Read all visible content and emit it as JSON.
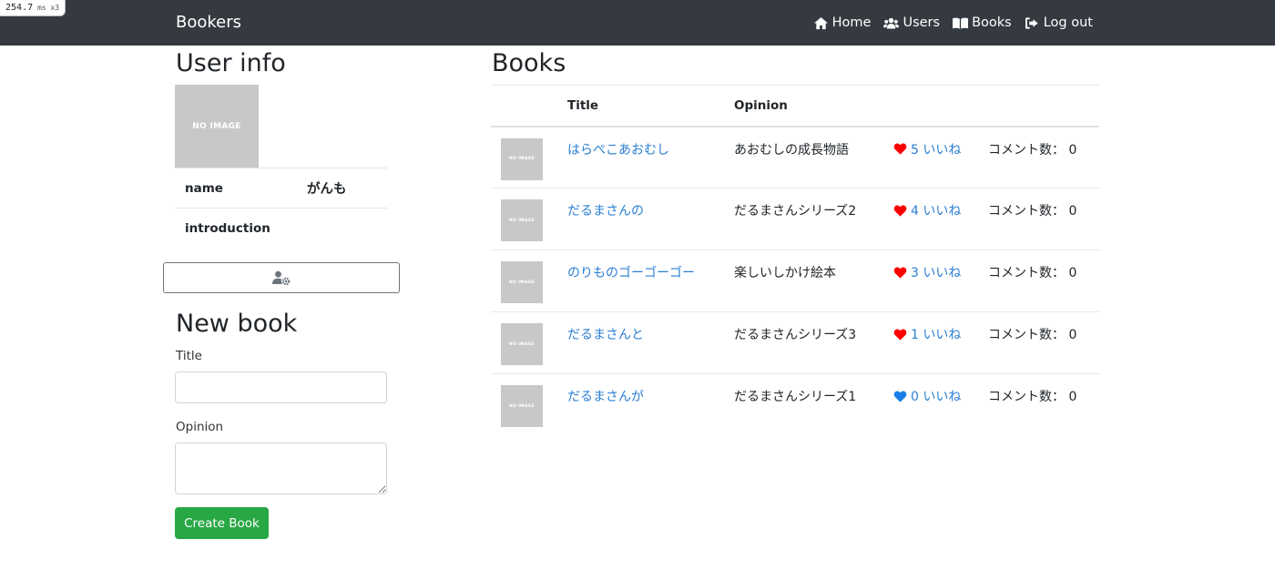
{
  "perf": {
    "value": "254.7",
    "unit": "ms",
    "mult": "x3"
  },
  "nav": {
    "brand": "Bookers",
    "links": [
      {
        "label": "Home",
        "icon": "home-icon"
      },
      {
        "label": "Users",
        "icon": "users-icon"
      },
      {
        "label": "Books",
        "icon": "book-icon"
      },
      {
        "label": "Log out",
        "icon": "logout-icon"
      }
    ]
  },
  "user_info": {
    "heading": "User info",
    "image_text": "NO IMAGE",
    "rows": [
      {
        "key": "name",
        "value": "がんも"
      },
      {
        "key": "introduction",
        "value": ""
      }
    ],
    "edit_icon": "user-cog-icon"
  },
  "new_book": {
    "heading": "New book",
    "title_label": "Title",
    "opinion_label": "Opinion",
    "title_value": "",
    "opinion_value": "",
    "submit_label": "Create Book"
  },
  "books": {
    "heading": "Books",
    "columns": [
      "",
      "Title",
      "Opinion",
      "",
      ""
    ],
    "thumb_text": "NO IMAGE",
    "rows": [
      {
        "title": "はらぺこあおむし",
        "opinion": "あおむしの成長物語",
        "likes": "5 いいね",
        "liked": true,
        "comments": "コメント数： 0"
      },
      {
        "title": "だるまさんの",
        "opinion": "だるまさんシリーズ2",
        "likes": "4 いいね",
        "liked": true,
        "comments": "コメント数： 0"
      },
      {
        "title": "のりものゴーゴーゴー",
        "opinion": "楽しいしかけ絵本",
        "likes": "3 いいね",
        "liked": true,
        "comments": "コメント数： 0"
      },
      {
        "title": "だるまさんと",
        "opinion": "だるまさんシリーズ3",
        "likes": "1 いいね",
        "liked": true,
        "comments": "コメント数： 0"
      },
      {
        "title": "だるまさんが",
        "opinion": "だるまさんシリーズ1",
        "likes": "0 いいね",
        "liked": false,
        "comments": "コメント数： 0"
      }
    ]
  },
  "colors": {
    "navbar": "#343a40",
    "link": "#2a7fd4",
    "liked_heart": "#ff0000",
    "unliked_heart": "#1a7ee8",
    "create_button": "#28a745"
  }
}
